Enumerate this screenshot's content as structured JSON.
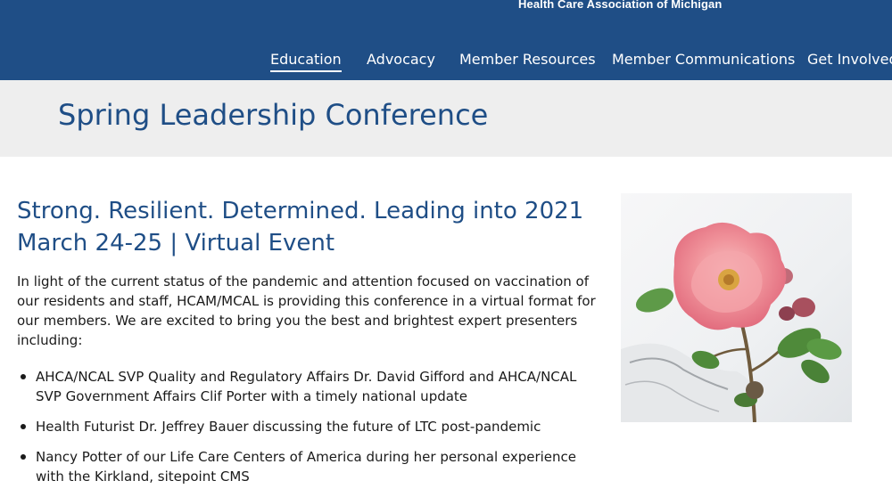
{
  "header": {
    "org_name": "Health Care Association of Michigan",
    "nav": [
      {
        "label": "Education",
        "active": true
      },
      {
        "label": "Advocacy"
      },
      {
        "label": "Member Resources"
      },
      {
        "label": "Member Communications"
      },
      {
        "label": "Get Involved"
      }
    ]
  },
  "page": {
    "title": "Spring Leadership Conference"
  },
  "content": {
    "headline_line1": "Strong. Resilient. Determined. Leading into 2021",
    "headline_line2": "March 24-25 | Virtual Event",
    "intro": "In light of the current status of the pandemic and attention focused on vaccination of our residents and staff, HCAM/MCAL is providing this conference in a virtual format for our members. We are excited to bring you the best and brightest expert presenters including:",
    "bullets": [
      "AHCA/NCAL SVP Quality and Regulatory Affairs Dr. David Gifford and AHCA/NCAL SVP Government Affairs Clif Porter with a timely national update",
      "Health Futurist Dr. Jeffrey Bauer discussing the future of LTC post-pandemic",
      "Nancy Potter of our Life Care Centers of America during her personal experience with the Kirkland, sitepoint CMS"
    ]
  },
  "colors": {
    "brand": "#1f4e86",
    "band": "#eeeeee",
    "text": "#1a1a1a"
  },
  "icons": {
    "photo": "pink-rose-photo"
  }
}
